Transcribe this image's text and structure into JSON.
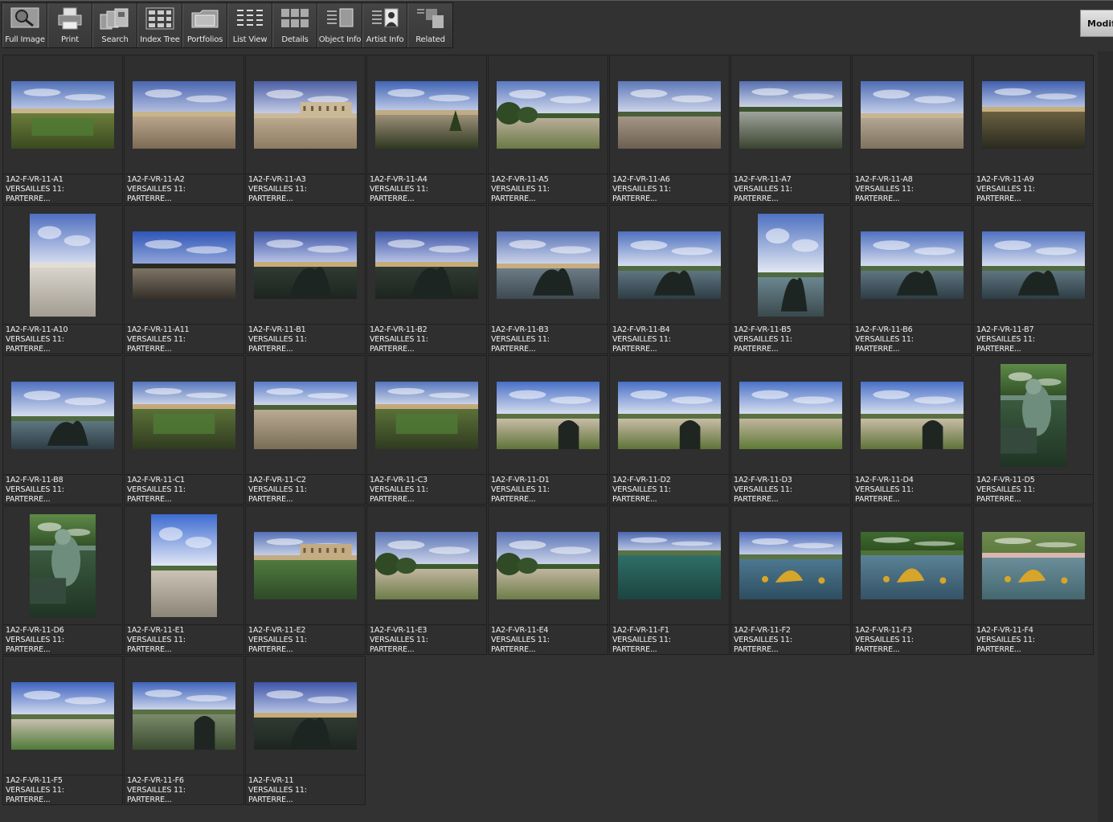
{
  "toolbar": {
    "buttons": [
      {
        "label": "Full Image",
        "icon": "magnifier-icon"
      },
      {
        "label": "Print",
        "icon": "printer-icon"
      },
      {
        "label": "Search",
        "icon": "search-icon"
      },
      {
        "label": "Index Tree",
        "icon": "index-tree-icon"
      },
      {
        "label": "Portfolios",
        "icon": "folder-icon"
      },
      {
        "label": "List View",
        "icon": "list-icon"
      },
      {
        "label": "Details",
        "icon": "details-icon"
      },
      {
        "label": "Object Info",
        "icon": "object-info-icon"
      },
      {
        "label": "Artist  Info",
        "icon": "artist-info-icon"
      },
      {
        "label": "Related",
        "icon": "related-icon"
      }
    ],
    "modify_label": "Modif"
  },
  "records": [
    {
      "id": "1A2-F-VR-11-A1",
      "line2": "VERSAILLES 11:",
      "line3": "PARTERRE...",
      "orientation": "landscape",
      "scene": "palace-garden"
    },
    {
      "id": "1A2-F-VR-11-A2",
      "line2": "VERSAILLES 11:",
      "line3": "PARTERRE...",
      "orientation": "landscape",
      "scene": "gravel-terrace"
    },
    {
      "id": "1A2-F-VR-11-A3",
      "line2": "VERSAILLES 11:",
      "line3": "PARTERRE...",
      "orientation": "landscape",
      "scene": "palace-facade"
    },
    {
      "id": "1A2-F-VR-11-A4",
      "line2": "VERSAILLES 11:",
      "line3": "PARTERRE...",
      "orientation": "landscape",
      "scene": "garden-path"
    },
    {
      "id": "1A2-F-VR-11-A5",
      "line2": "VERSAILLES 11:",
      "line3": "PARTERRE...",
      "orientation": "landscape",
      "scene": "trees-path"
    },
    {
      "id": "1A2-F-VR-11-A6",
      "line2": "VERSAILLES 11:",
      "line3": "PARTERRE...",
      "orientation": "landscape",
      "scene": "basin-view"
    },
    {
      "id": "1A2-F-VR-11-A7",
      "line2": "VERSAILLES 11:",
      "line3": "PARTERRE...",
      "orientation": "landscape",
      "scene": "stairs-view"
    },
    {
      "id": "1A2-F-VR-11-A8",
      "line2": "VERSAILLES 11:",
      "line3": "PARTERRE...",
      "orientation": "landscape",
      "scene": "balustrade"
    },
    {
      "id": "1A2-F-VR-11-A9",
      "line2": "VERSAILLES 11:",
      "line3": "PARTERRE...",
      "orientation": "landscape",
      "scene": "fountain-basin"
    },
    {
      "id": "1A2-F-VR-11-A10",
      "line2": "VERSAILLES 11:",
      "line3": "PARTERRE...",
      "orientation": "portrait",
      "scene": "urn-stairs"
    },
    {
      "id": "1A2-F-VR-11-A11",
      "line2": "VERSAILLES 11:",
      "line3": "PARTERRE...",
      "orientation": "landscape",
      "scene": "dark-path"
    },
    {
      "id": "1A2-F-VR-11-B1",
      "line2": "VERSAILLES 11:",
      "line3": "PARTERRE...",
      "orientation": "landscape",
      "scene": "statue-palace"
    },
    {
      "id": "1A2-F-VR-11-B2",
      "line2": "VERSAILLES 11:",
      "line3": "PARTERRE...",
      "orientation": "landscape",
      "scene": "statue-palace"
    },
    {
      "id": "1A2-F-VR-11-B3",
      "line2": "VERSAILLES 11:",
      "line3": "PARTERRE...",
      "orientation": "landscape",
      "scene": "palace-water"
    },
    {
      "id": "1A2-F-VR-11-B4",
      "line2": "VERSAILLES 11:",
      "line3": "PARTERRE...",
      "orientation": "landscape",
      "scene": "statue-water"
    },
    {
      "id": "1A2-F-VR-11-B5",
      "line2": "VERSAILLES 11:",
      "line3": "PARTERRE...",
      "orientation": "portrait",
      "scene": "statue-portrait"
    },
    {
      "id": "1A2-F-VR-11-B6",
      "line2": "VERSAILLES 11:",
      "line3": "PARTERRE...",
      "orientation": "landscape",
      "scene": "statue-water"
    },
    {
      "id": "1A2-F-VR-11-B7",
      "line2": "VERSAILLES 11:",
      "line3": "PARTERRE...",
      "orientation": "landscape",
      "scene": "statue-water"
    },
    {
      "id": "1A2-F-VR-11-B8",
      "line2": "VERSAILLES 11:",
      "line3": "PARTERRE...",
      "orientation": "landscape",
      "scene": "statue-water"
    },
    {
      "id": "1A2-F-VR-11-C1",
      "line2": "VERSAILLES 11:",
      "line3": "PARTERRE...",
      "orientation": "landscape",
      "scene": "orangerie"
    },
    {
      "id": "1A2-F-VR-11-C2",
      "line2": "VERSAILLES 11:",
      "line3": "PARTERRE...",
      "orientation": "landscape",
      "scene": "terrace-hedges"
    },
    {
      "id": "1A2-F-VR-11-C3",
      "line2": "VERSAILLES 11:",
      "line3": "PARTERRE...",
      "orientation": "landscape",
      "scene": "orangerie"
    },
    {
      "id": "1A2-F-VR-11-D1",
      "line2": "VERSAILLES 11:",
      "line3": "PARTERRE...",
      "orientation": "landscape",
      "scene": "urn-lawn"
    },
    {
      "id": "1A2-F-VR-11-D2",
      "line2": "VERSAILLES 11:",
      "line3": "PARTERRE...",
      "orientation": "landscape",
      "scene": "urn-lawn"
    },
    {
      "id": "1A2-F-VR-11-D3",
      "line2": "VERSAILLES 11:",
      "line3": "PARTERRE...",
      "orientation": "landscape",
      "scene": "lawn-view"
    },
    {
      "id": "1A2-F-VR-11-D4",
      "line2": "VERSAILLES 11:",
      "line3": "PARTERRE...",
      "orientation": "landscape",
      "scene": "urn-lawn"
    },
    {
      "id": "1A2-F-VR-11-D5",
      "line2": "VERSAILLES 11:",
      "line3": "PARTERRE...",
      "orientation": "portrait",
      "scene": "cherub-green"
    },
    {
      "id": "1A2-F-VR-11-D6",
      "line2": "VERSAILLES 11:",
      "line3": "PARTERRE...",
      "orientation": "portrait",
      "scene": "cherub-green"
    },
    {
      "id": "1A2-F-VR-11-E1",
      "line2": "VERSAILLES 11:",
      "line3": "PARTERRE...",
      "orientation": "portrait",
      "scene": "allee-portrait"
    },
    {
      "id": "1A2-F-VR-11-E2",
      "line2": "VERSAILLES 11:",
      "line3": "PARTERRE...",
      "orientation": "landscape",
      "scene": "palace-pond"
    },
    {
      "id": "1A2-F-VR-11-E3",
      "line2": "VERSAILLES 11:",
      "line3": "PARTERRE...",
      "orientation": "landscape",
      "scene": "allee-trees"
    },
    {
      "id": "1A2-F-VR-11-E4",
      "line2": "VERSAILLES 11:",
      "line3": "PARTERRE...",
      "orientation": "landscape",
      "scene": "allee-trees"
    },
    {
      "id": "1A2-F-VR-11-F1",
      "line2": "VERSAILLES 11:",
      "line3": "PARTERRE...",
      "orientation": "landscape",
      "scene": "green-basin"
    },
    {
      "id": "1A2-F-VR-11-F2",
      "line2": "VERSAILLES 11:",
      "line3": "PARTERRE...",
      "orientation": "landscape",
      "scene": "gold-fountain-far"
    },
    {
      "id": "1A2-F-VR-11-F3",
      "line2": "VERSAILLES 11:",
      "line3": "PARTERRE...",
      "orientation": "landscape",
      "scene": "gold-fountain"
    },
    {
      "id": "1A2-F-VR-11-F4",
      "line2": "VERSAILLES 11:",
      "line3": "PARTERRE...",
      "orientation": "landscape",
      "scene": "gold-fountain-pink"
    },
    {
      "id": "1A2-F-VR-11-F5",
      "line2": "VERSAILLES 11:",
      "line3": "PARTERRE...",
      "orientation": "landscape",
      "scene": "long-canal"
    },
    {
      "id": "1A2-F-VR-11-F6",
      "line2": "VERSAILLES 11:",
      "line3": "PARTERRE...",
      "orientation": "landscape",
      "scene": "canal-urn"
    },
    {
      "id": "1A2-F-VR-11",
      "line2": "VERSAILLES 11:",
      "line3": "PARTERRE...",
      "orientation": "landscape",
      "scene": "statue-palace"
    }
  ]
}
